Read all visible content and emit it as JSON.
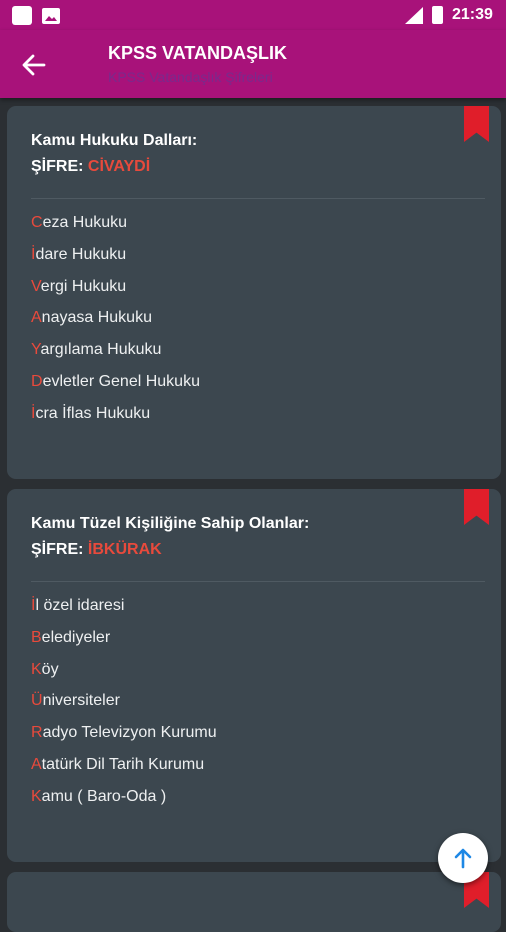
{
  "status_bar": {
    "time": "21:39"
  },
  "app_bar": {
    "title": "KPSS VATANDAŞLIK",
    "subtitle": "KPSS Vatandaşlık Şifreleri"
  },
  "colors": {
    "primary": "#a8127a",
    "card": "#3c474f",
    "accent": "#e84a3c",
    "bookmark": "#e01e2a"
  },
  "cards": [
    {
      "heading": "Kamu Hukuku Dalları:",
      "sifre_label": "ŞİFRE:",
      "sifre_value": "CİVAYDİ",
      "items": [
        {
          "first": "C",
          "rest": "eza Hukuku"
        },
        {
          "first": "İ",
          "rest": "dare Hukuku"
        },
        {
          "first": "V",
          "rest": "ergi Hukuku"
        },
        {
          "first": "A",
          "rest": "nayasa Hukuku"
        },
        {
          "first": "Y",
          "rest": "argılama Hukuku"
        },
        {
          "first": "D",
          "rest": "evletler Genel Hukuku"
        },
        {
          "first": "İ",
          "rest": "cra İflas Hukuku"
        }
      ]
    },
    {
      "heading": "Kamu Tüzel Kişiliğine Sahip Olanlar:",
      "sifre_label": "ŞİFRE:",
      "sifre_value": "İBKÜRAK",
      "items": [
        {
          "first": "İ",
          "rest": "l özel idaresi"
        },
        {
          "first": "B",
          "rest": "elediyeler"
        },
        {
          "first": "K",
          "rest": "öy"
        },
        {
          "first": "Ü",
          "rest": "niversiteler"
        },
        {
          "first": "R",
          "rest": "adyo Televizyon Kurumu"
        },
        {
          "first": "A",
          "rest": "tatürk Dil Tarih Kurumu"
        },
        {
          "first": "K",
          "rest": "amu ( Baro-Oda )"
        }
      ]
    }
  ],
  "icons": {
    "back": "arrow-left-icon",
    "scroll_top": "arrow-up-icon",
    "bookmark": "bookmark-icon"
  }
}
